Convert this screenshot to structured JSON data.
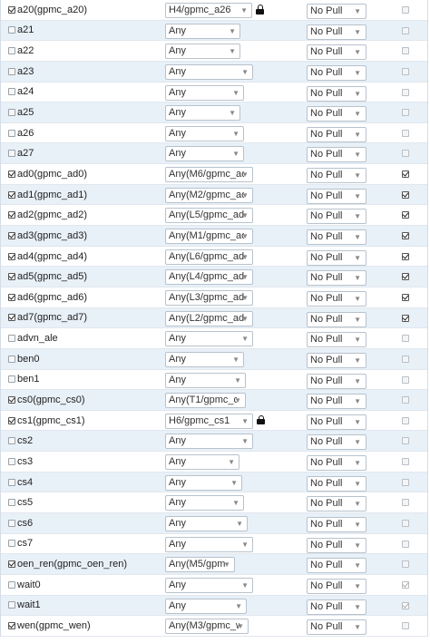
{
  "icons": {
    "mux_arrow": "chevron-down-icon",
    "pull_arrow": "chevron-down-icon",
    "lock": "lock-icon"
  },
  "colors": {
    "row_even": "#e8f0f8",
    "row_odd": "#ffffff",
    "border": "#b8c2cc"
  },
  "pins": [
    {
      "name": "a20(gpmc_a20)",
      "checked": true,
      "mux": "H4/gpmc_a26",
      "locked": true,
      "pull": "No Pull",
      "enabled": false
    },
    {
      "name": "a21",
      "checked": false,
      "mux": "Any",
      "locked": false,
      "pull": "No Pull",
      "enabled": false
    },
    {
      "name": "a22",
      "checked": false,
      "mux": "Any",
      "locked": false,
      "pull": "No Pull",
      "enabled": false
    },
    {
      "name": "a23",
      "checked": false,
      "mux": "Any",
      "locked": false,
      "pull": "No Pull",
      "enabled": false
    },
    {
      "name": "a24",
      "checked": false,
      "mux": "Any",
      "locked": false,
      "pull": "No Pull",
      "enabled": false
    },
    {
      "name": "a25",
      "checked": false,
      "mux": "Any",
      "locked": false,
      "pull": "No Pull",
      "enabled": false
    },
    {
      "name": "a26",
      "checked": false,
      "mux": "Any",
      "locked": false,
      "pull": "No Pull",
      "enabled": false
    },
    {
      "name": "a27",
      "checked": false,
      "mux": "Any",
      "locked": false,
      "pull": "No Pull",
      "enabled": false
    },
    {
      "name": "ad0(gpmc_ad0)",
      "checked": true,
      "mux": "Any(M6/gpmc_ac",
      "locked": false,
      "pull": "No Pull",
      "enabled": true
    },
    {
      "name": "ad1(gpmc_ad1)",
      "checked": true,
      "mux": "Any(M2/gpmc_ac",
      "locked": false,
      "pull": "No Pull",
      "enabled": true
    },
    {
      "name": "ad2(gpmc_ad2)",
      "checked": true,
      "mux": "Any(L5/gpmc_ad",
      "locked": false,
      "pull": "No Pull",
      "enabled": true
    },
    {
      "name": "ad3(gpmc_ad3)",
      "checked": true,
      "mux": "Any(M1/gpmc_ac",
      "locked": false,
      "pull": "No Pull",
      "enabled": true
    },
    {
      "name": "ad4(gpmc_ad4)",
      "checked": true,
      "mux": "Any(L6/gpmc_ad",
      "locked": false,
      "pull": "No Pull",
      "enabled": true
    },
    {
      "name": "ad5(gpmc_ad5)",
      "checked": true,
      "mux": "Any(L4/gpmc_ad",
      "locked": false,
      "pull": "No Pull",
      "enabled": true
    },
    {
      "name": "ad6(gpmc_ad6)",
      "checked": true,
      "mux": "Any(L3/gpmc_ad",
      "locked": false,
      "pull": "No Pull",
      "enabled": true
    },
    {
      "name": "ad7(gpmc_ad7)",
      "checked": true,
      "mux": "Any(L2/gpmc_ad",
      "locked": false,
      "pull": "No Pull",
      "enabled": true
    },
    {
      "name": "advn_ale",
      "checked": false,
      "mux": "Any",
      "locked": false,
      "pull": "No Pull",
      "enabled": false
    },
    {
      "name": "ben0",
      "checked": false,
      "mux": "Any",
      "locked": false,
      "pull": "No Pull",
      "enabled": false
    },
    {
      "name": "ben1",
      "checked": false,
      "mux": "Any",
      "locked": false,
      "pull": "No Pull",
      "enabled": false
    },
    {
      "name": "cs0(gpmc_cs0)",
      "checked": true,
      "mux": "Any(T1/gpmc_cs0",
      "locked": false,
      "pull": "No Pull",
      "enabled": false
    },
    {
      "name": "cs1(gpmc_cs1)",
      "checked": true,
      "mux": "H6/gpmc_cs1",
      "locked": true,
      "pull": "No Pull",
      "enabled": false
    },
    {
      "name": "cs2",
      "checked": false,
      "mux": "Any",
      "locked": false,
      "pull": "No Pull",
      "enabled": false
    },
    {
      "name": "cs3",
      "checked": false,
      "mux": "Any",
      "locked": false,
      "pull": "No Pull",
      "enabled": false
    },
    {
      "name": "cs4",
      "checked": false,
      "mux": "Any",
      "locked": false,
      "pull": "No Pull",
      "enabled": false
    },
    {
      "name": "cs5",
      "checked": false,
      "mux": "Any",
      "locked": false,
      "pull": "No Pull",
      "enabled": false
    },
    {
      "name": "cs6",
      "checked": false,
      "mux": "Any",
      "locked": false,
      "pull": "No Pull",
      "enabled": false
    },
    {
      "name": "cs7",
      "checked": false,
      "mux": "Any",
      "locked": false,
      "pull": "No Pull",
      "enabled": false
    },
    {
      "name": "oen_ren(gpmc_oen_ren)",
      "checked": true,
      "mux": "Any(M5/gpmc_oe",
      "locked": false,
      "pull": "No Pull",
      "enabled": false
    },
    {
      "name": "wait0",
      "checked": false,
      "mux": "Any",
      "locked": false,
      "pull": "No Pull",
      "enabled": true,
      "faint": true
    },
    {
      "name": "wait1",
      "checked": false,
      "mux": "Any",
      "locked": false,
      "pull": "No Pull",
      "enabled": true,
      "faint": true
    },
    {
      "name": "wen(gpmc_wen)",
      "checked": true,
      "mux": "Any(M3/gpmc_we",
      "locked": false,
      "pull": "No Pull",
      "enabled": false
    }
  ]
}
